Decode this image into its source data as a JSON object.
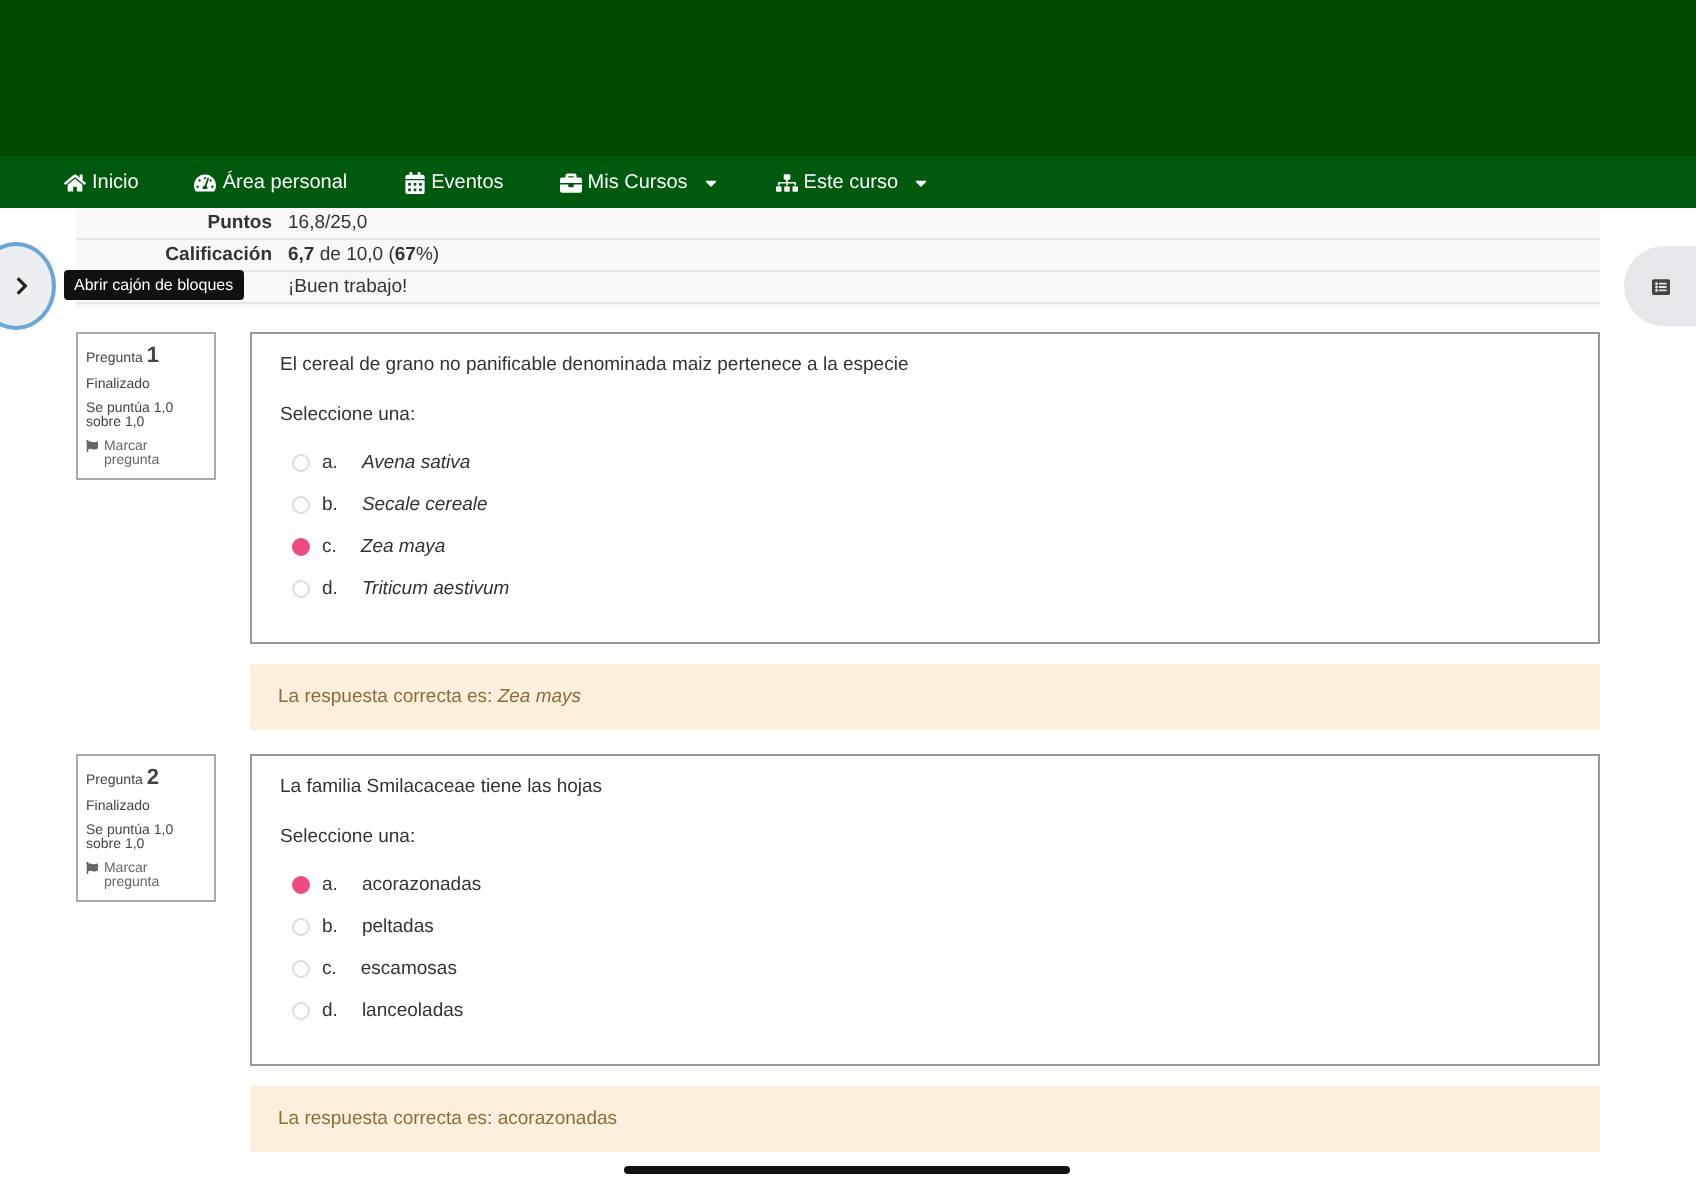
{
  "nav": [
    {
      "label": "Inicio",
      "dropdown": false
    },
    {
      "label": "Área personal",
      "dropdown": false
    },
    {
      "label": "Eventos",
      "dropdown": false
    },
    {
      "label": "Mis Cursos",
      "dropdown": true
    },
    {
      "label": "Este curso",
      "dropdown": true
    }
  ],
  "summary": [
    {
      "label": "Puntos",
      "value": "16,8/25,0"
    },
    {
      "label": "Calificación",
      "value": "**6,7** de 10,0 (**67**%)"
    },
    {
      "value": "¡Buen trabajo!"
    }
  ],
  "drawer_tooltip": "Abrir cajón de bloques",
  "questions": [
    {
      "prefix": "Pregunta",
      "number": "1",
      "status": "Finalizado",
      "score": "Se puntúa 1,0 sobre 1,0",
      "flag": "Marcar pregunta",
      "text": "El cereal de grano no panificable  denominada maiz pertenece a la especie",
      "prompt": "Seleccione una:",
      "options": [
        {
          "letter": "a.",
          "text": "*Avena sativa*",
          "selected": false
        },
        {
          "letter": "b.",
          "text": "*Secale cereale*",
          "selected": false
        },
        {
          "letter": "c.",
          "text": "*Zea maya*",
          "selected": true
        },
        {
          "letter": "d.",
          "text": "*Triticum aestivum*",
          "selected": false
        }
      ],
      "feedback": "La respuesta correcta es: *Zea mays*"
    },
    {
      "prefix": "Pregunta",
      "number": "2",
      "status": "Finalizado",
      "score": "Se puntúa 1,0 sobre 1,0",
      "flag": "Marcar pregunta",
      "text": "La familia Smilacaceae tiene las hojas",
      "prompt": "Seleccione una:",
      "options": [
        {
          "letter": "a.",
          "text": "acorazonadas",
          "selected": true
        },
        {
          "letter": "b.",
          "text": "peltadas",
          "selected": false
        },
        {
          "letter": "c.",
          "text": "escamosas",
          "selected": false
        },
        {
          "letter": "d.",
          "text": "lanceoladas",
          "selected": false
        }
      ],
      "feedback": "La respuesta correcta es: acorazonadas"
    }
  ]
}
